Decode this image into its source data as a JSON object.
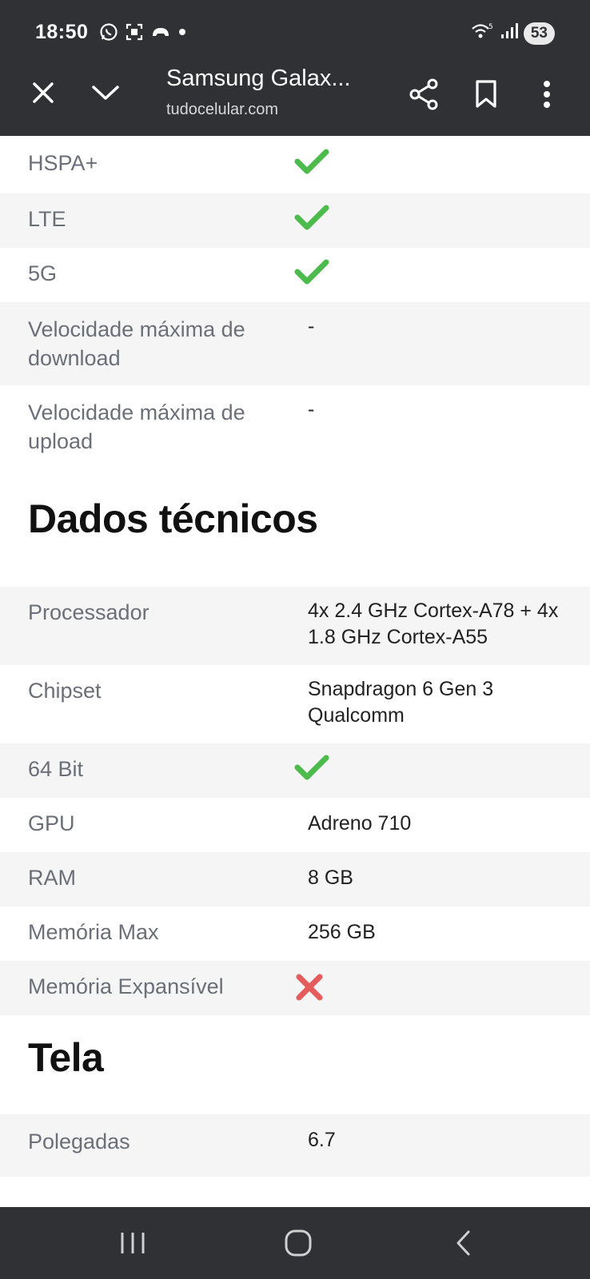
{
  "status_bar": {
    "time": "18:50",
    "battery": "53",
    "icons": [
      "whatsapp-icon",
      "screenshot-icon",
      "game-icon",
      "dot-icon",
      "wifi-5g-icon",
      "signal-icon"
    ]
  },
  "toolbar": {
    "title": "Samsung Galax...",
    "url": "tudocelular.com",
    "icons": [
      "close-icon",
      "chevron-down-icon",
      "share-icon",
      "bookmark-icon",
      "more-vert-icon"
    ]
  },
  "network_rows": [
    {
      "label": "HSPA+",
      "status": "yes"
    },
    {
      "label": "LTE",
      "status": "yes"
    },
    {
      "label": "5G",
      "status": "yes"
    },
    {
      "label": "Velocidade máxima de download",
      "value": "-"
    },
    {
      "label": "Velocidade máxima de upload",
      "value": "-"
    }
  ],
  "sections": {
    "technical": {
      "title": "Dados técnicos",
      "rows": [
        {
          "label": "Processador",
          "value": "4x 2.4 GHz Cortex-A78 + 4x 1.8 GHz Cortex-A55"
        },
        {
          "label": "Chipset",
          "value": "Snapdragon 6 Gen 3 Qualcomm"
        },
        {
          "label": "64 Bit",
          "status": "yes"
        },
        {
          "label": "GPU",
          "value": "Adreno 710"
        },
        {
          "label": "RAM",
          "value": "8 GB"
        },
        {
          "label": "Memória Max",
          "value": "256 GB"
        },
        {
          "label": "Memória Expansível",
          "status": "no"
        }
      ]
    },
    "screen": {
      "title": "Tela",
      "rows": [
        {
          "label": "Polegadas",
          "value": "6.7"
        }
      ]
    }
  },
  "colors": {
    "check": "#4cbb4c",
    "cross": "#e55c5c",
    "bar": "#2f3134"
  },
  "nav_bar": {
    "icons": [
      "recents-icon",
      "home-icon",
      "back-icon"
    ]
  }
}
